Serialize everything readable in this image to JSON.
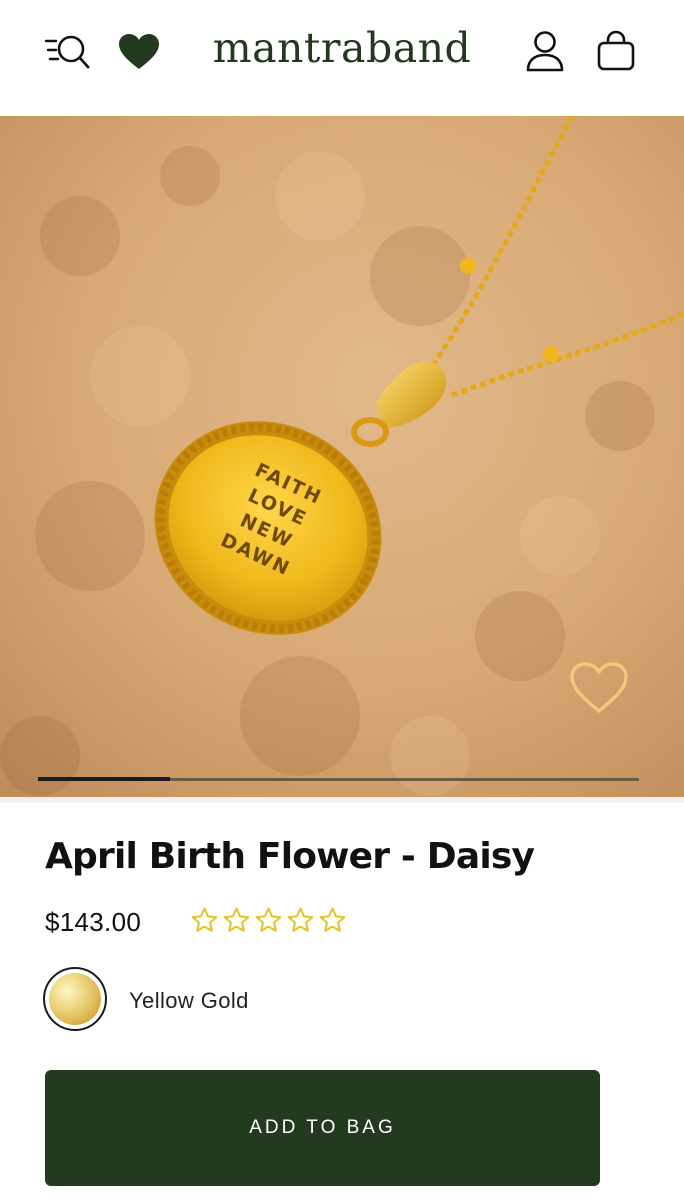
{
  "header": {
    "brand": "mantraband",
    "search_icon": "search-menu-icon",
    "wishlist_icon": "heart-filled-icon",
    "account_icon": "user-icon",
    "bag_icon": "shopping-bag-icon"
  },
  "gallery": {
    "pendant_text": [
      "FAITH",
      "LOVE",
      "NEW",
      "DAWN"
    ],
    "wishlist_icon": "heart-outline-icon",
    "progress": 0.22
  },
  "product": {
    "title": "April Birth Flower - Daisy",
    "price": "$143.00",
    "rating": 0,
    "rating_max": 5,
    "variant_label": "Yellow Gold",
    "add_to_bag_label": "ADD TO BAG"
  },
  "colors": {
    "brand_green": "#223b1e",
    "star_yellow": "#e8c21a",
    "gold": "#e6b21c"
  }
}
